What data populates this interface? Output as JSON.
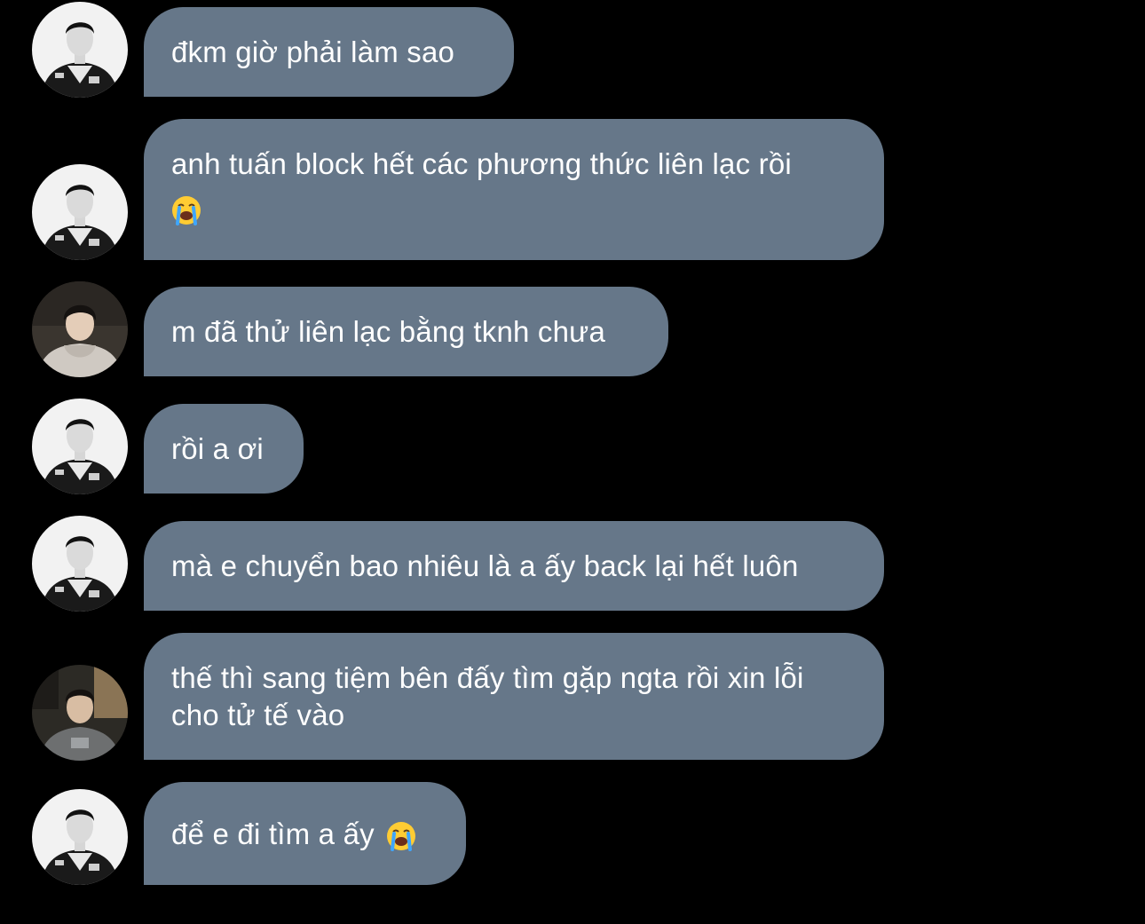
{
  "messages": [
    {
      "sender": "user-a",
      "text": "đkm giờ phải làm sao",
      "emoji": ""
    },
    {
      "sender": "user-a",
      "text": "anh tuấn block hết các phương thức liên lạc rồi",
      "emoji": "loudly-crying-face"
    },
    {
      "sender": "user-b",
      "text": "m đã thử liên lạc bằng tknh chưa",
      "emoji": ""
    },
    {
      "sender": "user-a",
      "text": "rồi a ơi",
      "emoji": ""
    },
    {
      "sender": "user-a",
      "text": "mà e chuyển bao nhiêu là a ấy back lại hết luôn",
      "emoji": ""
    },
    {
      "sender": "user-c",
      "text": "thế thì sang tiệm bên đấy tìm gặp ngta rồi xin lỗi cho tử tế vào",
      "emoji": ""
    },
    {
      "sender": "user-a",
      "text": "để e đi tìm a ấy",
      "emoji": "loudly-crying-face"
    }
  ],
  "colors": {
    "background": "#000000",
    "bubble": "#667789",
    "text": "#ffffff"
  }
}
